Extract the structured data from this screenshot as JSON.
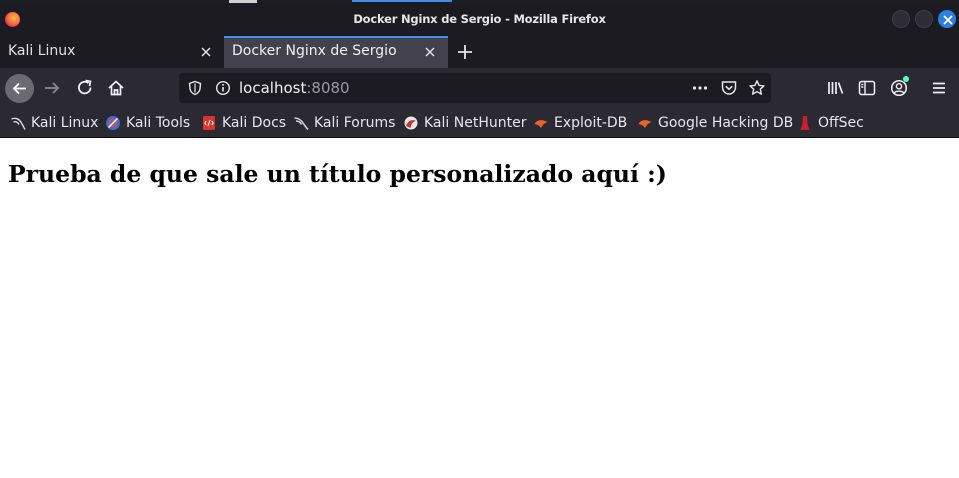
{
  "window": {
    "title": "Docker Nginx de Sergio - Mozilla Firefox",
    "app_icon": "firefox-icon"
  },
  "tabs": [
    {
      "label": "Kali Linux",
      "active": false
    },
    {
      "label": "Docker Nginx de Sergio",
      "active": true
    }
  ],
  "navbar": {
    "url_host": "localhost",
    "url_port": ":8080"
  },
  "bookmarks": [
    {
      "label": "Kali Linux",
      "icon": "kali-dragon-icon"
    },
    {
      "label": "Kali Tools",
      "icon": "kali-tools-icon"
    },
    {
      "label": "Kali Docs",
      "icon": "kali-docs-icon"
    },
    {
      "label": "Kali Forums",
      "icon": "kali-dragon-icon"
    },
    {
      "label": "Kali NetHunter",
      "icon": "nethunter-icon"
    },
    {
      "label": "Exploit-DB",
      "icon": "exploit-db-icon"
    },
    {
      "label": "Google Hacking DB",
      "icon": "ghdb-icon"
    },
    {
      "label": "OffSec",
      "icon": "offsec-icon"
    }
  ],
  "page": {
    "heading": "Prueba de que sale un título personalizado aquí :)"
  },
  "colors": {
    "chrome_dark": "#1c1b22",
    "toolbar": "#2b2a33",
    "active_tab": "#42414d",
    "accent": "#3f8fee"
  }
}
